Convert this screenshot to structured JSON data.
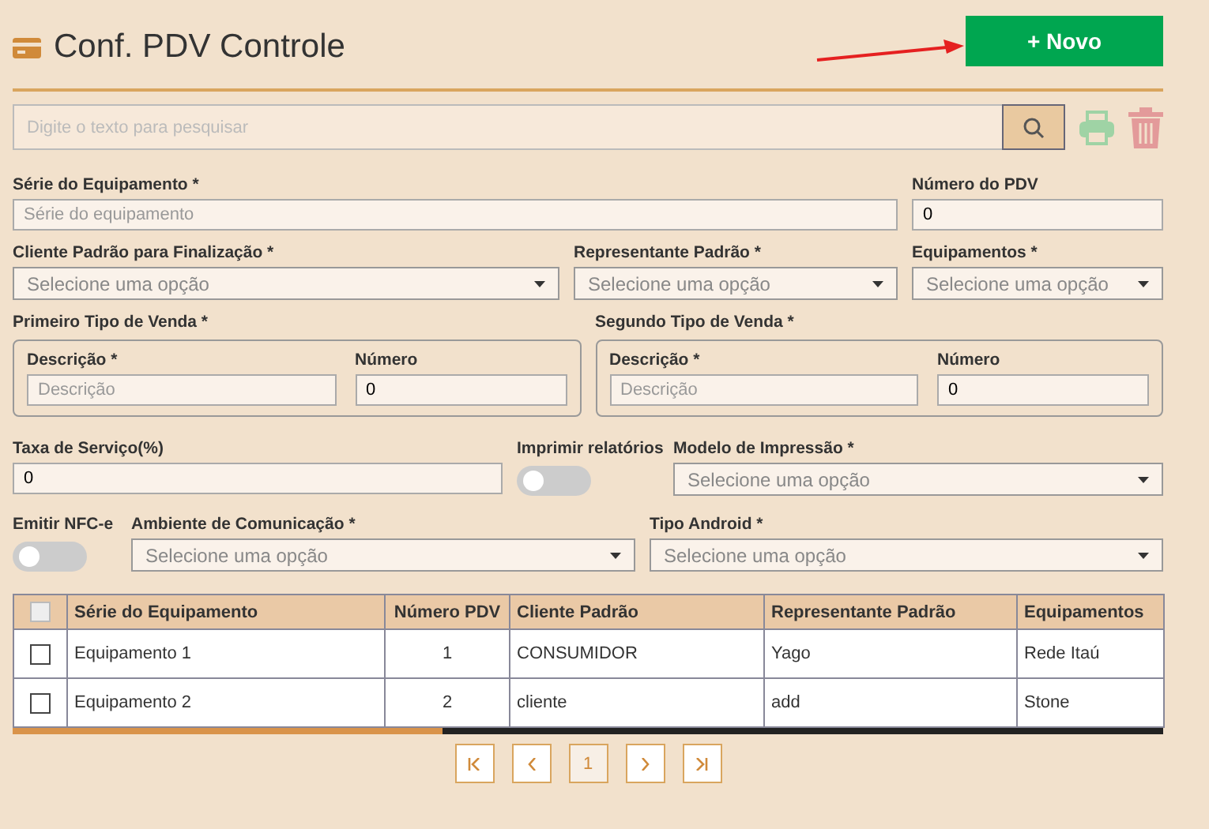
{
  "header": {
    "title": "Conf. PDV Controle",
    "new_button": "+ Novo"
  },
  "search": {
    "placeholder": "Digite o texto para pesquisar"
  },
  "serie": {
    "label": "Série do Equipamento *",
    "placeholder": "Série do equipamento"
  },
  "numero_pdv": {
    "label": "Número do PDV",
    "value": "0"
  },
  "cliente_padrao": {
    "label": "Cliente Padrão para Finalização *",
    "placeholder": "Selecione uma opção"
  },
  "representante_padrao": {
    "label": "Representante Padrão *",
    "placeholder": "Selecione uma opção"
  },
  "equipamentos": {
    "label": "Equipamentos *",
    "placeholder": "Selecione uma opção"
  },
  "tipos_de_venda": [
    {
      "label": "Primeiro Tipo de Venda *",
      "descricao": {
        "label": "Descrição *",
        "placeholder": "Descrição"
      },
      "numero": {
        "label": "Número",
        "value": "0"
      }
    },
    {
      "label": "Segundo Tipo de Venda *",
      "descricao": {
        "label": "Descrição *",
        "placeholder": "Descrição"
      },
      "numero": {
        "label": "Número",
        "value": "0"
      }
    }
  ],
  "taxa_servico": {
    "label": "Taxa de Serviço(%)",
    "value": "0"
  },
  "imprimir_relatorios": {
    "label": "Imprimir relatórios",
    "on": false
  },
  "modelo_impressao": {
    "label": "Modelo de Impressão *",
    "placeholder": "Selecione uma opção"
  },
  "emitir_nfce": {
    "label": "Emitir NFC-e",
    "on": false
  },
  "ambiente_comunicacao": {
    "label": "Ambiente de Comunicação *",
    "placeholder": "Selecione uma opção"
  },
  "tipo_android": {
    "label": "Tipo Android *",
    "placeholder": "Selecione uma opção"
  },
  "table": {
    "header_checked": false,
    "columns": [
      "Série do Equipamento",
      "Número PDV",
      "Cliente Padrão",
      "Representante Padrão",
      "Equipamentos"
    ],
    "rows": [
      {
        "selected": false,
        "cells": [
          "Equipamento 1",
          "1",
          "CONSUMIDOR",
          "Yago",
          "Rede Itaú"
        ]
      },
      {
        "selected": false,
        "cells": [
          "Equipamento 2",
          "2",
          "cliente",
          "add",
          "Stone"
        ]
      }
    ]
  },
  "pagination": {
    "page": "1"
  }
}
